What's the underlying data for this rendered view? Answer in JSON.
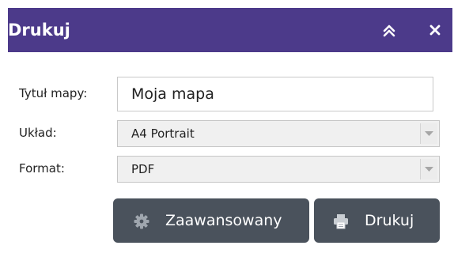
{
  "header": {
    "title": "Drukuj",
    "collapse_icon": "double-chevron-up-icon",
    "close_icon": "close-icon"
  },
  "form": {
    "title_label": "Tytuł mapy:",
    "title_value": "Moja mapa",
    "layout_label": "Układ:",
    "layout_value": "A4 Portrait",
    "format_label": "Format:",
    "format_value": "PDF"
  },
  "buttons": {
    "advanced_label": "Zaawansowany",
    "advanced_icon": "gear-icon",
    "print_label": "Drukuj",
    "print_icon": "printer-icon"
  },
  "colors": {
    "header_background": "#4c3a8a",
    "button_background": "#4a525c"
  }
}
